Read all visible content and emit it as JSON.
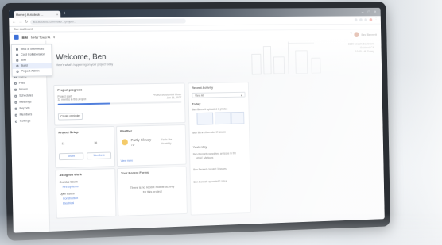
{
  "browser": {
    "tab_title": "Home | Autodesk ...",
    "url": "acc.autodesk.com/build/.../project/...",
    "bookmarks": "Dev dashboard"
  },
  "app": {
    "name": "BIM",
    "project": "NHW Tower A",
    "user": "Bec Bennett"
  },
  "menu": {
    "items": [
      "Bids & Submittals",
      "Cost Collaboration",
      "BIM",
      "Build",
      "Project Admin"
    ]
  },
  "sidebar": {
    "items": [
      "Home",
      "Files",
      "Issues",
      "Schedules",
      "Meetings",
      "Reports",
      "Members",
      "Settings"
    ]
  },
  "hero": {
    "welcome": "Welcome, Ben",
    "subtitle": "Here's what's happening on your project today",
    "address_lines": [
      "3150 Lincoln Boulevard",
      "Oakland, CA",
      "10:15 AM, Sunny"
    ]
  },
  "project_progress": {
    "title": "Project progress",
    "left_label": "Project start",
    "left_sub": "32 months in this project",
    "right_label": "Project Substantial Close",
    "right_sub": "Jan 16, 2027",
    "progress": 0.42,
    "button": "Create reminder"
  },
  "project_setup": {
    "title": "Project Setup",
    "stat1": "12",
    "stat2": "36",
    "btn1": "Share",
    "btn2": "Members"
  },
  "weather": {
    "title": "Weather",
    "condition": "Partly Cloudy",
    "temp": "71°",
    "detail1": "Feels like",
    "detail2": "Humidity",
    "more": "View more"
  },
  "assigned": {
    "title": "Assigned Work",
    "group1": "Overdue Issues",
    "item1": "Fire Systems",
    "group2": "Open Issues",
    "item2": "Construction",
    "item3": "Electrical"
  },
  "recent": {
    "title": "Your Recent Forms",
    "empty": "There is no recent mobile activity for this project"
  },
  "recent_activity": {
    "title": "Recent Activity",
    "filter": "View All",
    "today": "Today",
    "entry1": "Ben Bennett uploaded 3 photos",
    "entry2": "Ben Bennett created 2 issues",
    "yesterday": "Yesterday",
    "entry3": "Ben Bennett completed an issue in the",
    "entry3b": "HVAC Markups",
    "entry4": "Ben Bennett created 3 issues",
    "entry5": "Ben Bennett uploaded 1 issue"
  }
}
